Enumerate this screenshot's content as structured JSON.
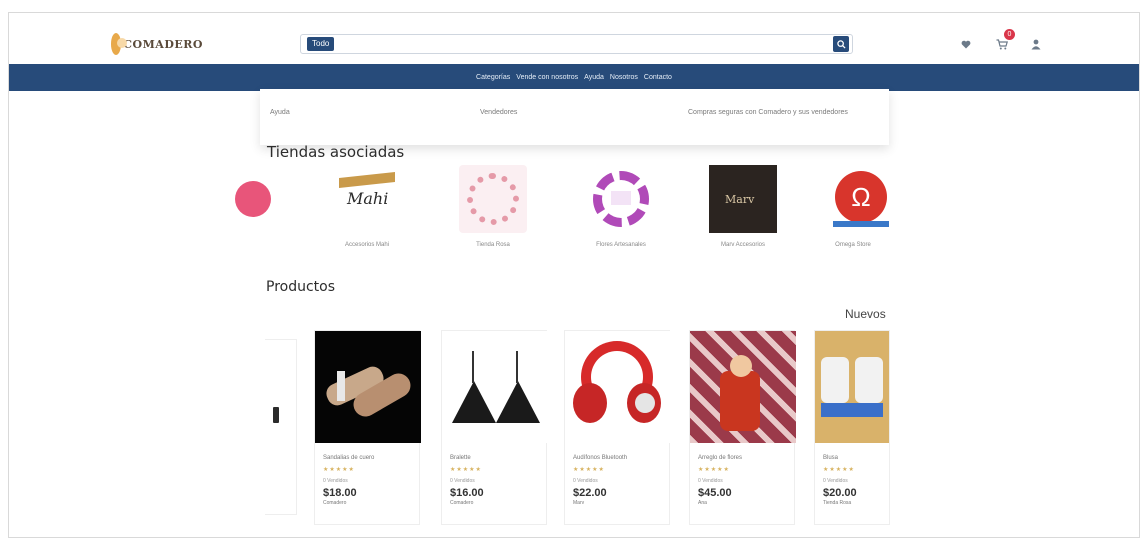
{
  "header": {
    "logo_text": "COMADERO",
    "search": {
      "scope_label": "Todo",
      "placeholder": ""
    },
    "icons": [
      "search-icon",
      "heart-icon",
      "cart-icon",
      "user-icon"
    ],
    "cart_count": "0"
  },
  "navbar": {
    "items": [
      "Categorías",
      "Vende con nosotros",
      "Ayuda",
      "Nosotros",
      "Contacto"
    ]
  },
  "top_card": {
    "texts": [
      "Ayuda",
      "Vendedores",
      "Compras seguras con Comadero y sus vendedores"
    ]
  },
  "stores": {
    "title": "Tiendas asociadas",
    "items": [
      {
        "name": ""
      },
      {
        "name": "Accesorios Mahi"
      },
      {
        "name": "Tienda Rosa"
      },
      {
        "name": "Flores Artesanales"
      },
      {
        "name": "Marv Accesorios"
      },
      {
        "name": "Omega Store"
      }
    ]
  },
  "products": {
    "title": "Productos",
    "tab_label": "Nuevos",
    "items": [
      {
        "name": "Sandalias de cuero",
        "stars": "★★★★★",
        "sold": "0 Vendidos",
        "price": "$18.00",
        "seller": "Comadero"
      },
      {
        "name": "Bralette",
        "stars": "★★★★★",
        "sold": "0 Vendidos",
        "price": "$16.00",
        "seller": "Comadero"
      },
      {
        "name": "Audífonos Bluetooth",
        "stars": "★★★★★",
        "sold": "0 Vendidos",
        "price": "$22.00",
        "seller": "Marv"
      },
      {
        "name": "Arreglo de flores",
        "stars": "★★★★★",
        "sold": "0 Vendidos",
        "price": "$45.00",
        "seller": "Ana"
      },
      {
        "name": "Blusa",
        "stars": "★★★★★",
        "sold": "0 Vendidos",
        "price": "$20.00",
        "seller": "Tienda Rosa"
      }
    ]
  },
  "colors": {
    "brand_blue": "#274b7a",
    "badge_red": "#d9364a",
    "star_gold": "#d7b25f"
  }
}
